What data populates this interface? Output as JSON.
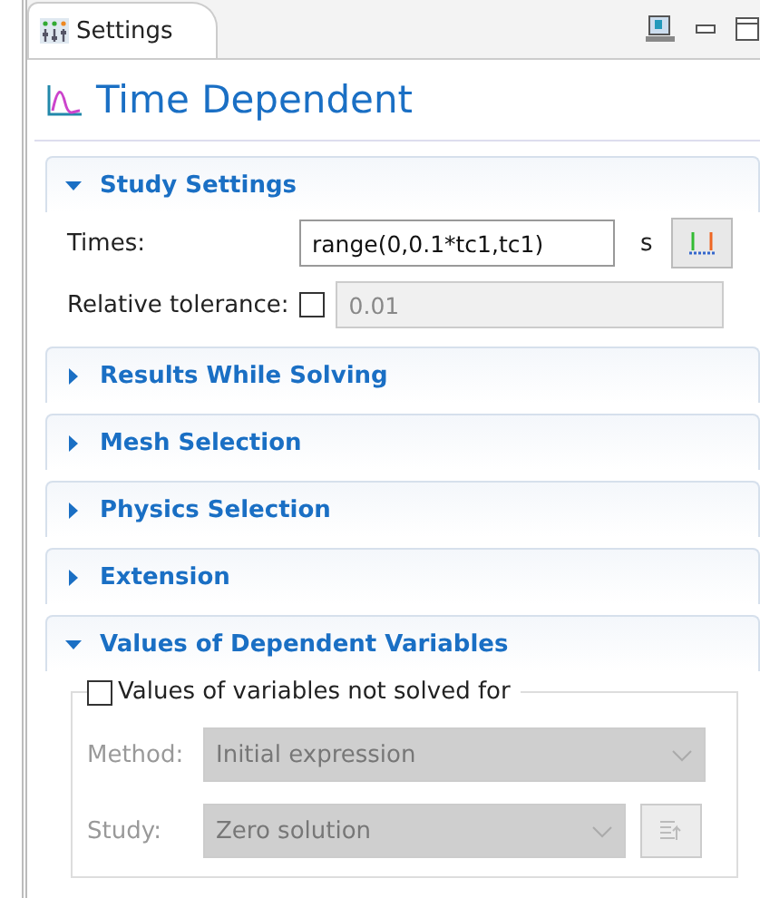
{
  "tab": {
    "label": "Settings",
    "selected": true
  },
  "title": "Time Dependent",
  "sections": [
    {
      "title": "Study Settings",
      "expanded": true,
      "kind": "study",
      "times": {
        "label": "Times:",
        "value": "range(0,0.1*tc1,tc1)",
        "unit": "s"
      },
      "tolerance": {
        "label": "Relative tolerance:",
        "checked": false,
        "value": "0.01",
        "disabled": true
      }
    },
    {
      "title": "Results While Solving",
      "expanded": false
    },
    {
      "title": "Mesh Selection",
      "expanded": false
    },
    {
      "title": "Physics Selection",
      "expanded": false
    },
    {
      "title": "Extension",
      "expanded": false
    },
    {
      "title": "Values of Dependent Variables",
      "expanded": true,
      "kind": "dependent",
      "group": {
        "label": "Values of variables not solved for",
        "checked": false,
        "method": {
          "label": "Method:",
          "value": "Initial expression",
          "disabled": true
        },
        "study": {
          "label": "Study:",
          "value": "Zero solution",
          "disabled": true
        }
      }
    }
  ]
}
